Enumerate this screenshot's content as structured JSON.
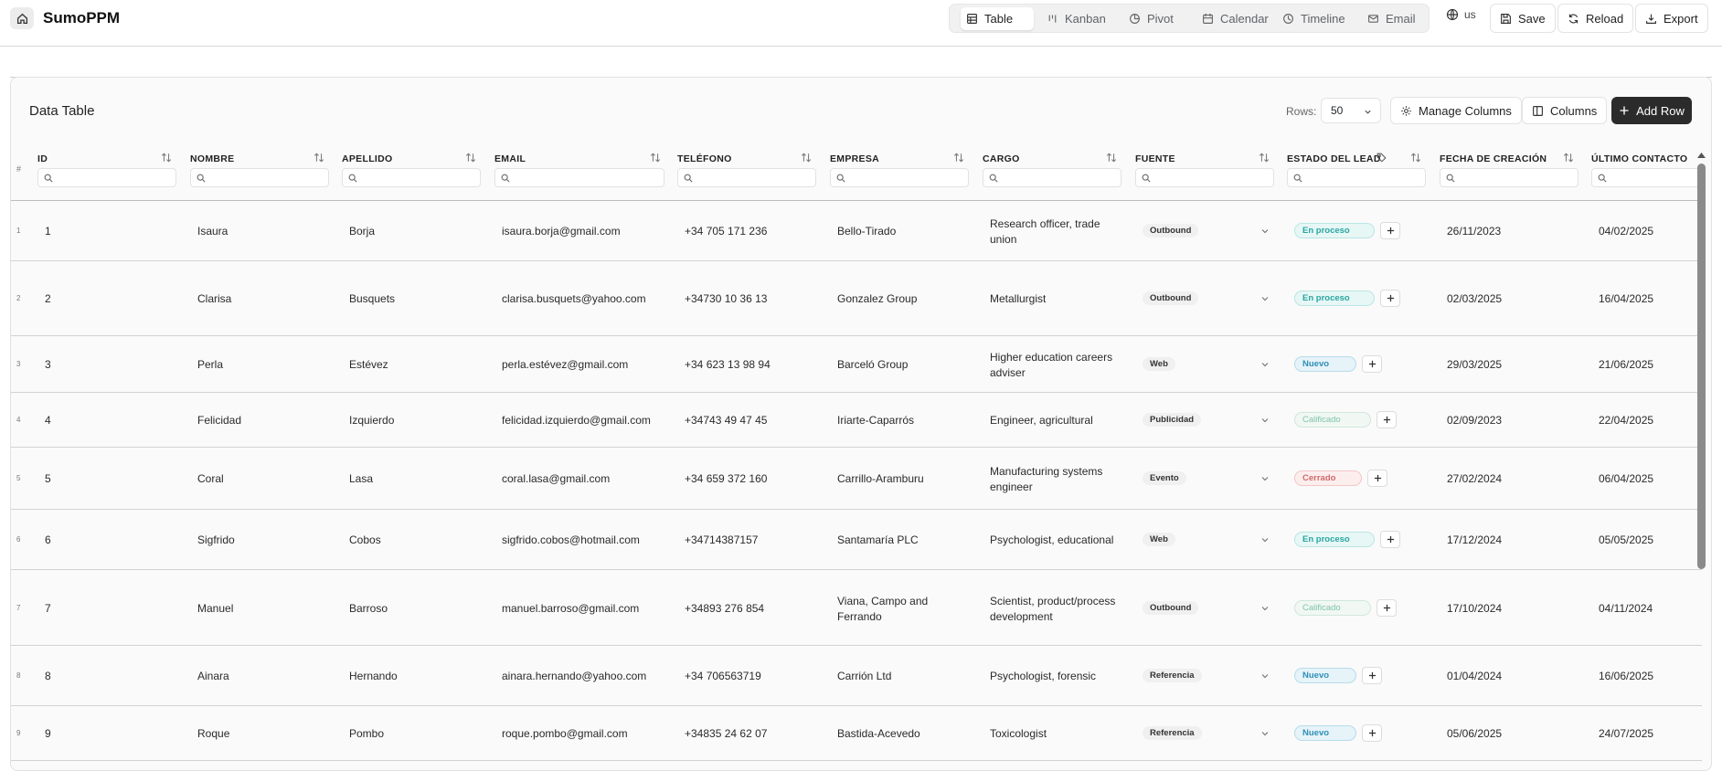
{
  "app": {
    "title": "SumoPPM"
  },
  "views": [
    {
      "label": "Table",
      "icon": "table-icon",
      "active": true
    },
    {
      "label": "Kanban",
      "icon": "kanban-icon",
      "active": false
    },
    {
      "label": "Pivot",
      "icon": "pie-chart-icon",
      "active": false
    },
    {
      "label": "Calendar",
      "icon": "calendar-icon",
      "active": false
    },
    {
      "label": "Timeline",
      "icon": "clock-icon",
      "active": false
    },
    {
      "label": "Email",
      "icon": "mail-icon",
      "active": false
    }
  ],
  "toolbar": {
    "language": "us",
    "save_label": "Save",
    "reload_label": "Reload",
    "export_label": "Export"
  },
  "card": {
    "title": "Data Table",
    "rows_label": "Rows:",
    "rows_value": "50",
    "manage_columns_label": "Manage Columns",
    "columns_label": "Columns",
    "add_row_label": "Add Row"
  },
  "table": {
    "rownum_header": "#",
    "columns": [
      "ID",
      "NOMBRE",
      "APELLIDO",
      "EMAIL",
      "TELÉFONO",
      "EMPRESA",
      "CARGO",
      "FUENTE",
      "ESTADO DEL LEAD",
      "FECHA DE CREACIÓN",
      "ÚLTIMO CONTACTO"
    ],
    "rows": [
      {
        "n": "1",
        "id": "1",
        "nombre": "Isaura",
        "apellido": "Borja",
        "email": "isaura.borja@gmail.com",
        "telefono": "+34 705 171 236",
        "empresa": "Bello-Tirado",
        "cargo": [
          "Research officer, trade",
          "union"
        ],
        "fuente": "Outbound",
        "estado": "En proceso",
        "fecha": "26/11/2023",
        "ultimo": "04/02/2025"
      },
      {
        "n": "2",
        "id": "2",
        "nombre": "Clarisa",
        "apellido": "Busquets",
        "email": "clarisa.busquets@yahoo.com",
        "telefono": "+34730 10 36 13",
        "empresa": "Gonzalez Group",
        "cargo": [
          "Metallurgist"
        ],
        "fuente": "Outbound",
        "estado": "En proceso",
        "fecha": "02/03/2025",
        "ultimo": "16/04/2025"
      },
      {
        "n": "3",
        "id": "3",
        "nombre": "Perla",
        "apellido": "Estévez",
        "email": "perla.estévez@gmail.com",
        "telefono": "+34 623 13 98 94",
        "empresa": "Barceló Group",
        "cargo": [
          "Higher education careers",
          "adviser"
        ],
        "fuente": "Web",
        "estado": "Nuevo",
        "fecha": "29/03/2025",
        "ultimo": "21/06/2025"
      },
      {
        "n": "4",
        "id": "4",
        "nombre": "Felicidad",
        "apellido": "Izquierdo",
        "email": "felicidad.izquierdo@gmail.com",
        "telefono": "+34743 49 47 45",
        "empresa": "Iriarte-Caparrós",
        "cargo": [
          "Engineer, agricultural"
        ],
        "fuente": "Publicidad",
        "estado": "Calificado",
        "fecha": "02/09/2023",
        "ultimo": "22/04/2025"
      },
      {
        "n": "5",
        "id": "5",
        "nombre": "Coral",
        "apellido": "Lasa",
        "email": "coral.lasa@gmail.com",
        "telefono": "+34 659 372 160",
        "empresa": "Carrillo-Aramburu",
        "cargo": [
          "Manufacturing systems",
          "engineer"
        ],
        "fuente": "Evento",
        "estado": "Cerrado",
        "fecha": "27/02/2024",
        "ultimo": "06/04/2025"
      },
      {
        "n": "6",
        "id": "6",
        "nombre": "Sigfrido",
        "apellido": "Cobos",
        "email": "sigfrido.cobos@hotmail.com",
        "telefono": "+34714387157",
        "empresa": "Santamaría PLC",
        "cargo": [
          "Psychologist, educational"
        ],
        "fuente": "Web",
        "estado": "En proceso",
        "fecha": "17/12/2024",
        "ultimo": "05/05/2025"
      },
      {
        "n": "7",
        "id": "7",
        "nombre": "Manuel",
        "apellido": "Barroso",
        "email": "manuel.barroso@gmail.com",
        "telefono": "+34893 276 854",
        "empresa": [
          "Viana, Campo and",
          "Ferrando"
        ],
        "cargo": [
          "Scientist, product/process",
          "development"
        ],
        "fuente": "Outbound",
        "estado": "Calificado",
        "fecha": "17/10/2024",
        "ultimo": "04/11/2024"
      },
      {
        "n": "8",
        "id": "8",
        "nombre": "Ainara",
        "apellido": "Hernando",
        "email": "ainara.hernando@yahoo.com",
        "telefono": "+34 706563719",
        "empresa": "Carrión Ltd",
        "cargo": [
          "Psychologist, forensic"
        ],
        "fuente": "Referencia",
        "estado": "Nuevo",
        "fecha": "01/04/2024",
        "ultimo": "16/06/2025"
      },
      {
        "n": "9",
        "id": "9",
        "nombre": "Roque",
        "apellido": "Pombo",
        "email": "roque.pombo@gmail.com",
        "telefono": "+34835 24 62 07",
        "empresa": "Bastida-Acevedo",
        "cargo": [
          "Toxicologist"
        ],
        "fuente": "Referencia",
        "estado": "Nuevo",
        "fecha": "05/06/2025",
        "ultimo": "24/07/2025"
      }
    ]
  }
}
